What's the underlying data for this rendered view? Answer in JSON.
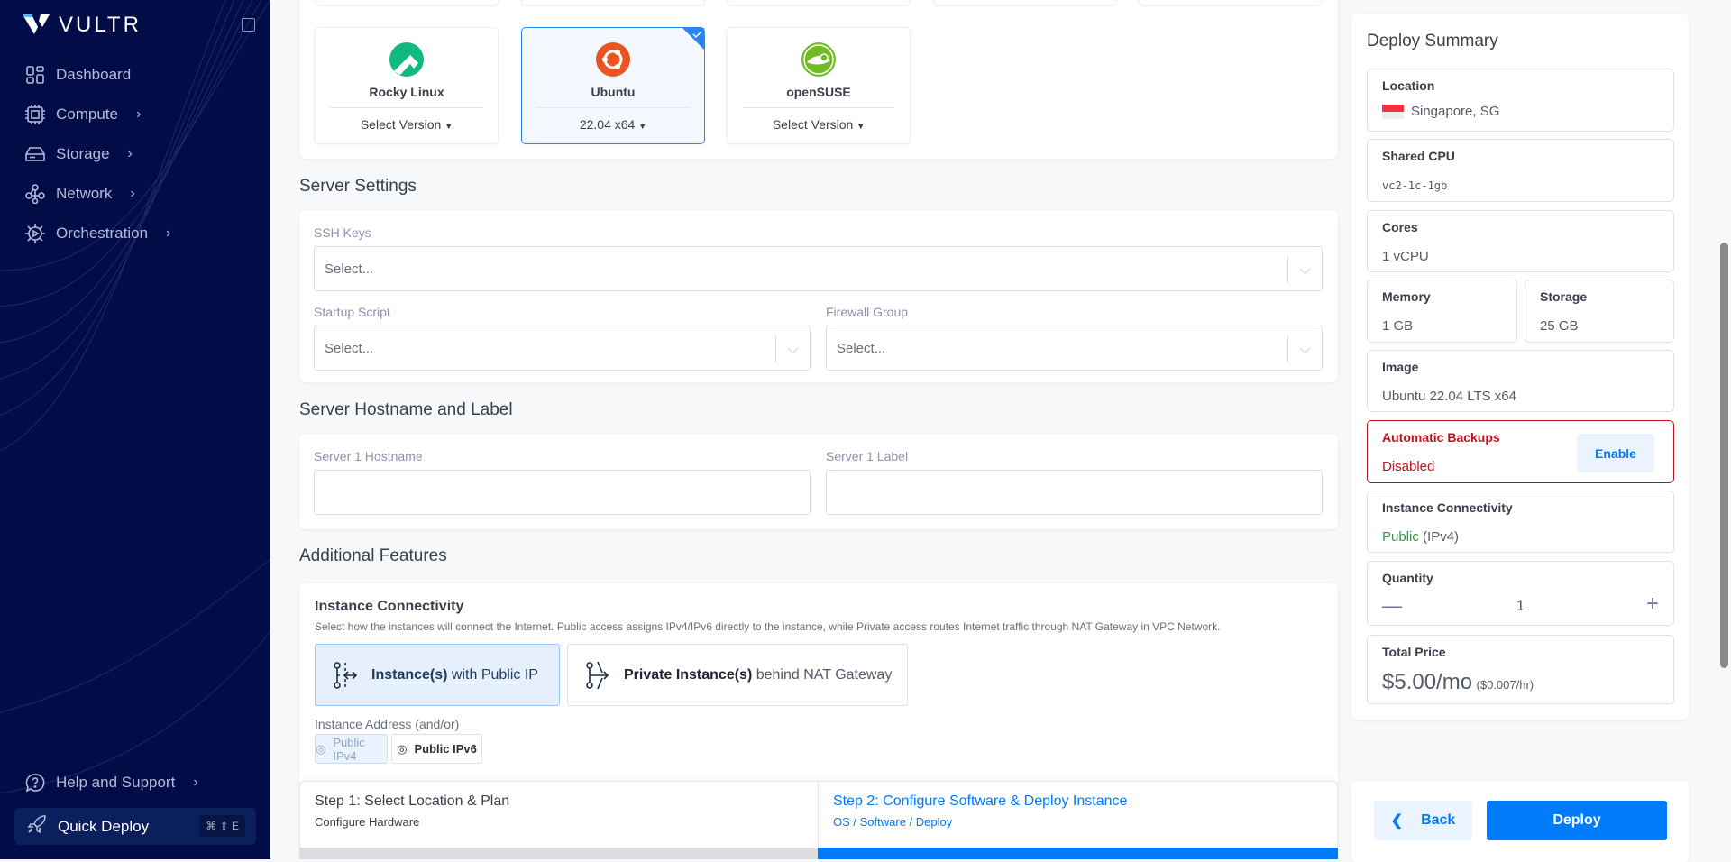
{
  "sidebar": {
    "brand": "VULTR",
    "items": [
      {
        "label": "Dashboard",
        "icon": "dashboard-icon"
      },
      {
        "label": "Compute",
        "icon": "cpu-icon"
      },
      {
        "label": "Storage",
        "icon": "storage-icon"
      },
      {
        "label": "Network",
        "icon": "network-icon"
      },
      {
        "label": "Orchestration",
        "icon": "orchestration-icon"
      }
    ],
    "help": "Help and Support",
    "quick_deploy": "Quick Deploy",
    "shortcut": "⌘ ⇧ E"
  },
  "os": {
    "cards": [
      {
        "name": "Rocky Linux",
        "version": "Select Version",
        "selected": false,
        "color": "#10b981"
      },
      {
        "name": "Ubuntu",
        "version": "22.04 x64",
        "selected": true,
        "color": "#e95420"
      },
      {
        "name": "openSUSE",
        "version": "Select Version",
        "selected": false,
        "color": "#73ba25"
      }
    ]
  },
  "server_settings": {
    "title": "Server Settings",
    "ssh_label": "SSH Keys",
    "ssh_placeholder": "Select...",
    "startup_label": "Startup Script",
    "startup_placeholder": "Select...",
    "firewall_label": "Firewall Group",
    "firewall_placeholder": "Select..."
  },
  "hostname": {
    "title": "Server Hostname and Label",
    "hostname_label": "Server 1 Hostname",
    "label_label": "Server 1 Label"
  },
  "features": {
    "title": "Additional Features",
    "conn_title": "Instance Connectivity",
    "conn_desc": "Select how the instances will connect the Internet. Public access assigns IPv4/IPv6 directly to the instance, while Private access routes Internet traffic through NAT Gateway in VPC Network.",
    "opt1_bold": "Instance(s)",
    "opt1_rest": " with Public IP",
    "opt2_bold": "Private Instance(s)",
    "opt2_rest": " behind NAT Gateway",
    "addr_label": "Instance Address (and/or)",
    "ipv4": "Public IPv4",
    "ipv6": "Public IPv6"
  },
  "steps": {
    "step1_title": "Step 1: Select Location & Plan",
    "step1_sub": "Configure Hardware",
    "step2_title": "Step 2: Configure Software & Deploy Instance",
    "step2_sub": "OS / Software / Deploy"
  },
  "summary": {
    "title": "Deploy Summary",
    "location_label": "Location",
    "location": "Singapore, SG",
    "cpu_label": "Shared CPU",
    "cpu": "vc2-1c-1gb",
    "cores_label": "Cores",
    "cores": "1 vCPU",
    "memory_label": "Memory",
    "memory": "1 GB",
    "storage_label": "Storage",
    "storage": "25 GB",
    "image_label": "Image",
    "image": "Ubuntu 22.04 LTS x64",
    "backups_label": "Automatic Backups",
    "backups": "Disabled",
    "enable": "Enable",
    "conn_label": "Instance Connectivity",
    "conn_public": "Public",
    "conn_rest": " (IPv4)",
    "qty_label": "Quantity",
    "qty": "1",
    "price_label": "Total Price",
    "price": "$5.00/mo",
    "hourly": "($0.007/hr)"
  },
  "actions": {
    "back": "Back",
    "deploy": "Deploy"
  },
  "colors": {
    "accent": "#007bfc",
    "danger": "#c0111f",
    "success": "#2e9b46"
  }
}
